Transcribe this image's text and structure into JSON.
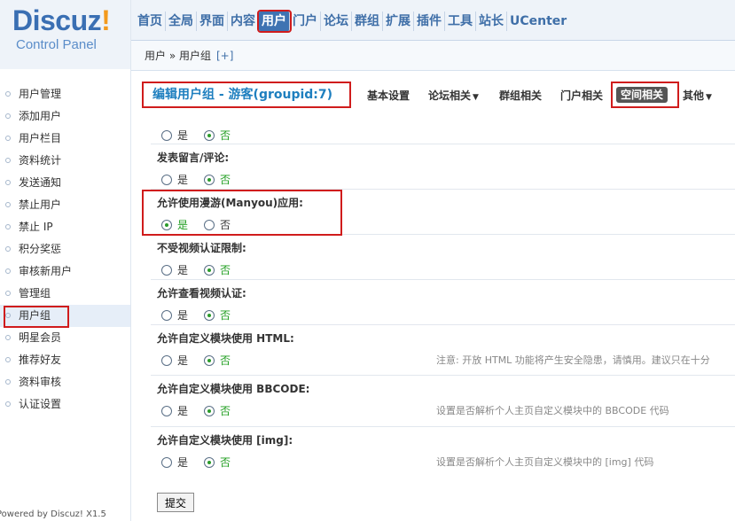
{
  "logo": {
    "word_left": "Discuz",
    "word_mark": "!",
    "subtitle": "Control Panel"
  },
  "topnav": [
    "首页",
    "全局",
    "界面",
    "内容",
    "用户",
    "门户",
    "论坛",
    "群组",
    "扩展",
    "插件",
    "工具",
    "站长",
    "UCenter"
  ],
  "topnav_active": "用户",
  "breadcrumb": {
    "path": "用户 » 用户组",
    "add": "[+]"
  },
  "sidebar": {
    "items": [
      "用户管理",
      "添加用户",
      "用户栏目",
      "资料统计",
      "发送通知",
      "禁止用户",
      "禁止 IP",
      "积分奖惩",
      "审核新用户",
      "管理组",
      "用户组",
      "明星会员",
      "推荐好友",
      "资料审核",
      "认证设置"
    ],
    "active": "用户组",
    "powered_by": "Powered by Discuz! X1.5"
  },
  "subbar": {
    "title": "编辑用户组 - 游客(groupid:7)",
    "tabs": [
      {
        "label": "基本设置",
        "dropdown": false
      },
      {
        "label": "论坛相关",
        "dropdown": true
      },
      {
        "label": "群组相关",
        "dropdown": false
      },
      {
        "label": "门户相关",
        "dropdown": false
      },
      {
        "label": "空间相关",
        "dropdown": false,
        "active": true
      },
      {
        "label": "其他",
        "dropdown": true
      }
    ],
    "caret": "▼"
  },
  "form": {
    "yes": "是",
    "no": "否",
    "rows": [
      {
        "label": "",
        "value": "no",
        "hint": ""
      },
      {
        "label": "发表留言/评论:",
        "value": "no",
        "hint": ""
      },
      {
        "label": "允许使用漫游(Manyou)应用:",
        "value": "yes",
        "hint": ""
      },
      {
        "label": "不受视频认证限制:",
        "value": "no",
        "hint": ""
      },
      {
        "label": "允许查看视频认证:",
        "value": "no",
        "hint": ""
      },
      {
        "label": "允许自定义模块使用 HTML:",
        "value": "no",
        "hint": "注意: 开放 HTML 功能将产生安全隐患，请慎用。建议只在十分"
      },
      {
        "label": "允许自定义模块使用 BBCODE:",
        "value": "no",
        "hint": "设置是否解析个人主页自定义模块中的 BBCODE 代码"
      },
      {
        "label": "允许自定义模块使用 [img]:",
        "value": "no",
        "hint": "设置是否解析个人主页自定义模块中的 [img] 代码"
      }
    ]
  },
  "submit_label": "提交",
  "colors": {
    "nav_text": "#3f6fa8",
    "highlight": "#d01c1c",
    "radio_on": "#2a9b2a",
    "title": "#1e7fbf"
  }
}
